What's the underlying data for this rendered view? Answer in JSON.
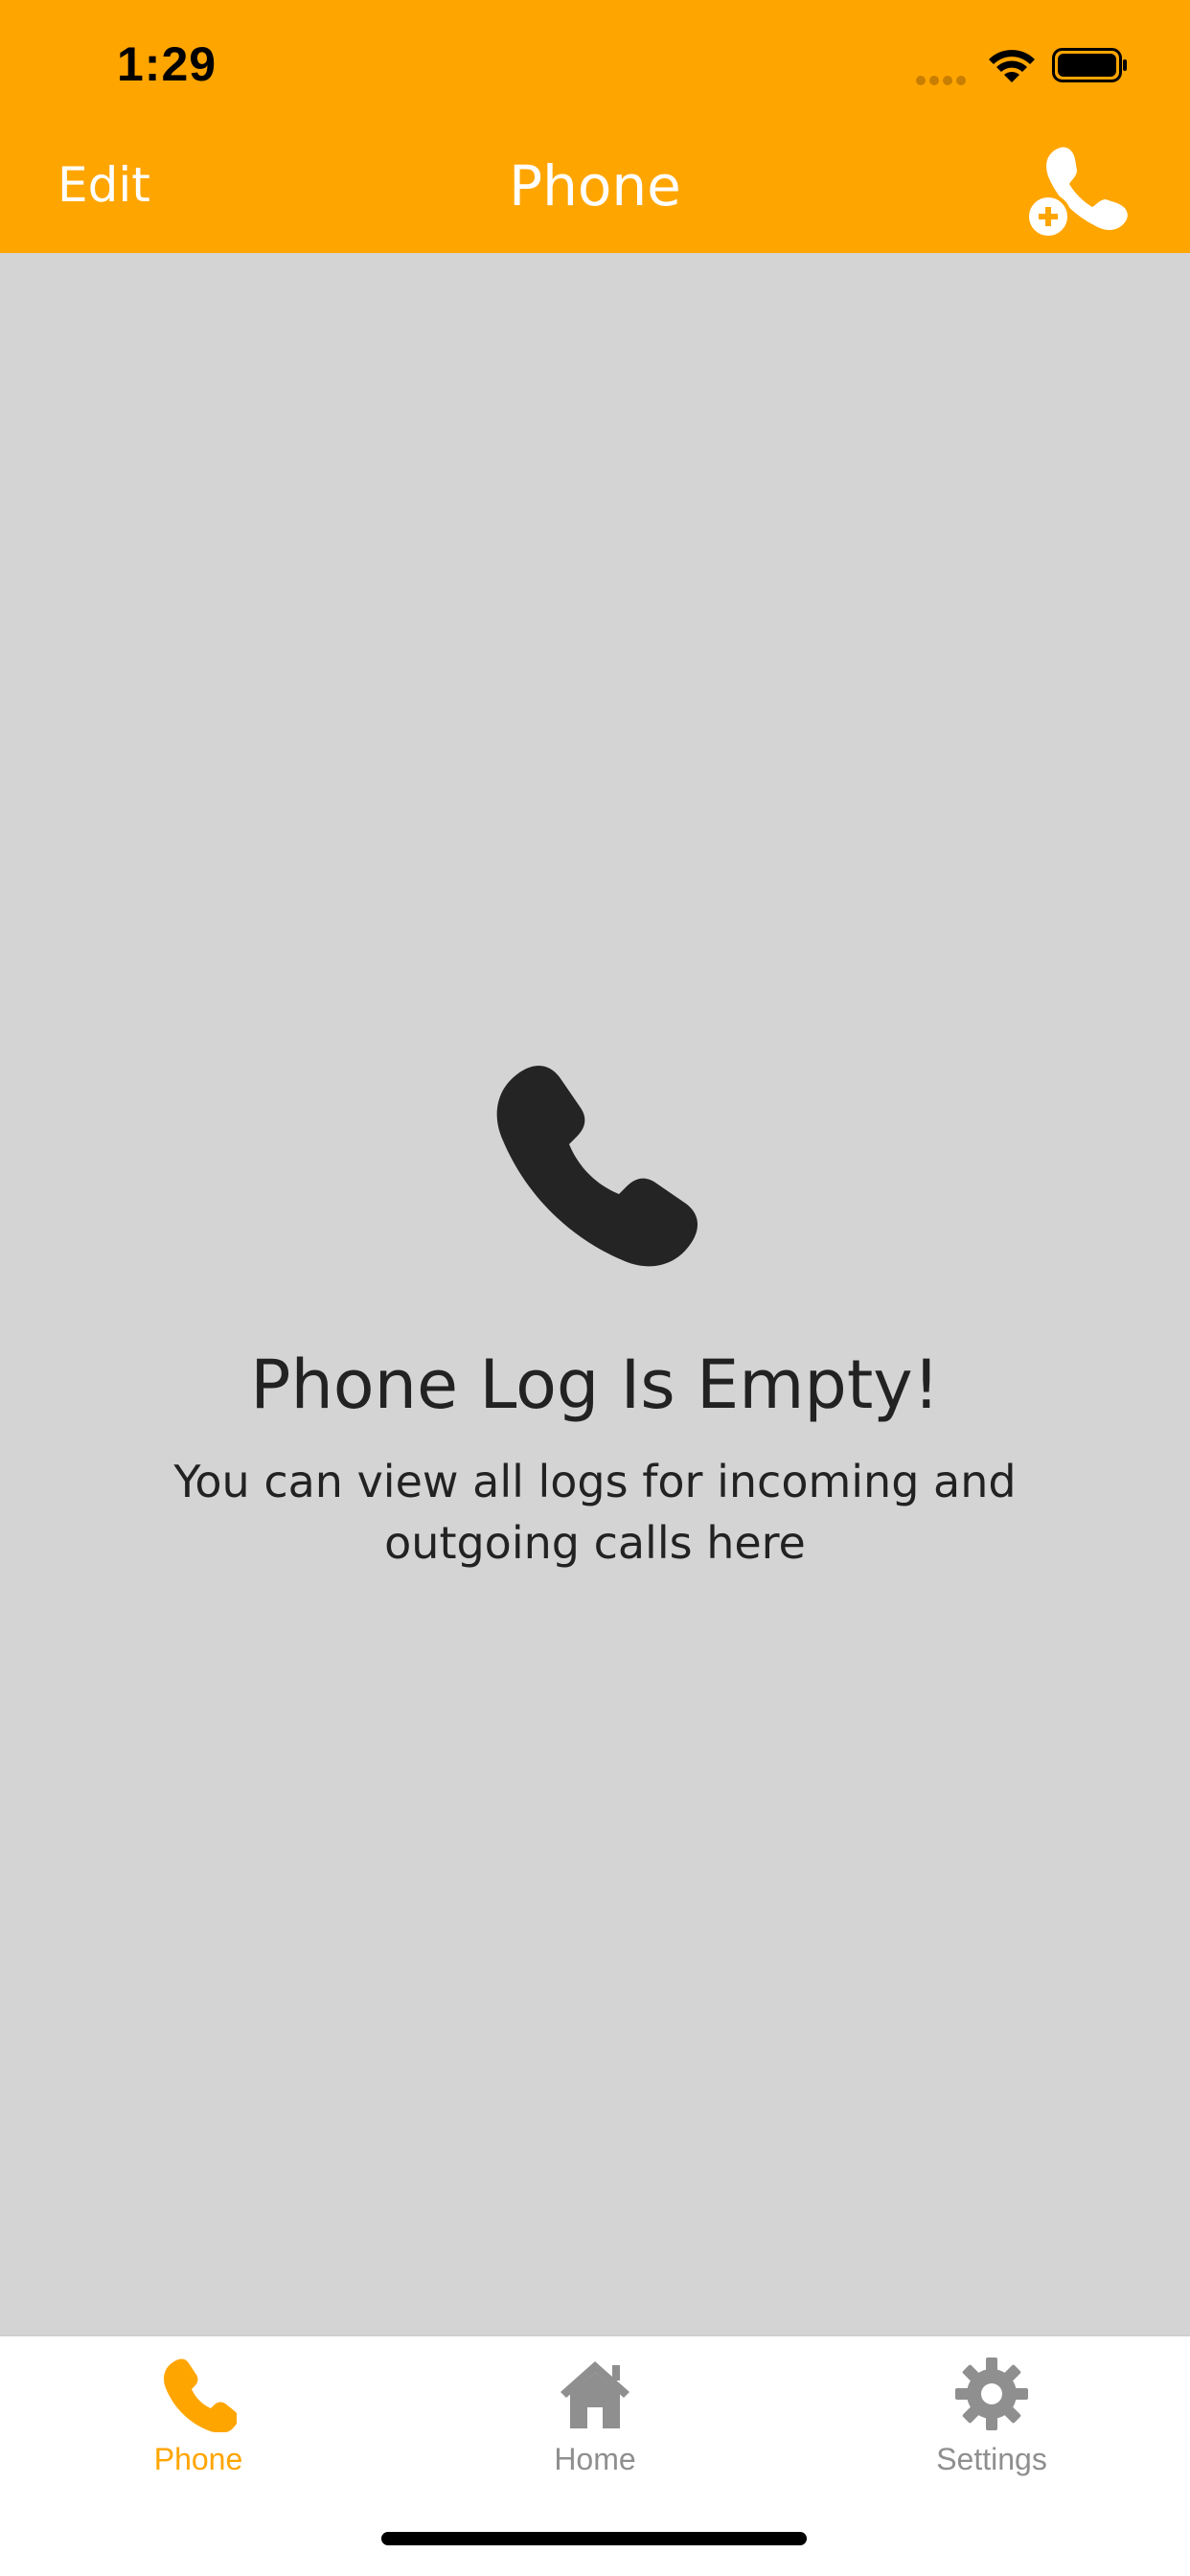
{
  "status_bar": {
    "time": "1:29",
    "icons": [
      "signal-dots-icon",
      "wifi-icon",
      "battery-icon"
    ]
  },
  "header": {
    "edit_label": "Edit",
    "title": "Phone",
    "add_icon": "add-call-icon"
  },
  "empty_state": {
    "icon": "phone-icon",
    "title": "Phone Log Is Empty!",
    "subtitle": "You can view all logs for incoming and outgoing calls here"
  },
  "tabbar": {
    "tabs": [
      {
        "label": "Phone",
        "icon": "phone-icon",
        "active": true
      },
      {
        "label": "Home",
        "icon": "home-icon",
        "active": false
      },
      {
        "label": "Settings",
        "icon": "gear-icon",
        "active": false
      }
    ]
  },
  "colors": {
    "accent": "#ffa500",
    "background": "#d4d4d4",
    "text": "#222222",
    "inactive": "#8f8f8f"
  }
}
